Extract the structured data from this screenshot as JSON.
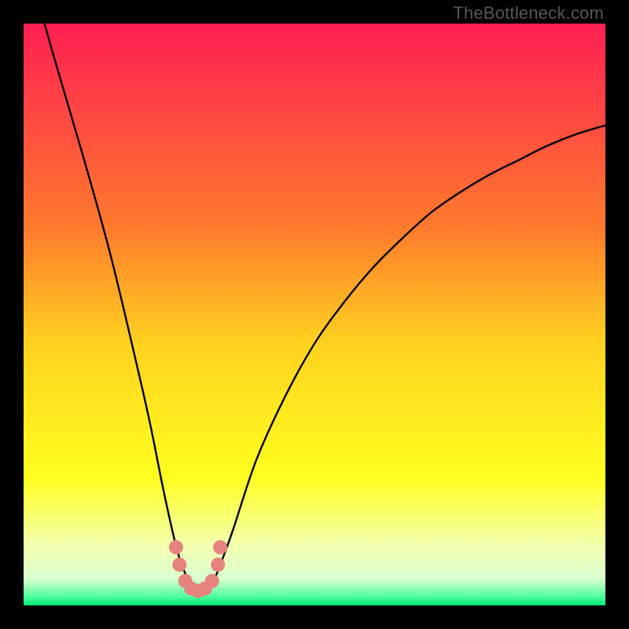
{
  "watermark": {
    "text": "TheBottleneck.com"
  },
  "chart_data": {
    "type": "line",
    "title": "",
    "xlabel": "",
    "ylabel": "",
    "xlim": [
      0,
      100
    ],
    "ylim": [
      0,
      100
    ],
    "x": [
      0,
      5,
      10,
      15,
      20,
      22,
      24,
      26,
      27,
      28,
      29,
      30,
      31,
      32,
      33,
      34,
      36,
      40,
      45,
      50,
      55,
      60,
      65,
      70,
      75,
      80,
      85,
      90,
      95,
      100
    ],
    "values": [
      113,
      95,
      78,
      60,
      39,
      30,
      20,
      11,
      7.5,
      5,
      3.2,
      2.5,
      2.5,
      3.2,
      5,
      7.5,
      13,
      25,
      36,
      45,
      52,
      58,
      63,
      67.5,
      71,
      74,
      76.5,
      79,
      81,
      82.5
    ],
    "minimum_x": 30,
    "gradient_stops": [
      {
        "pos": 0.0,
        "color": "#ff1f53"
      },
      {
        "pos": 0.35,
        "color": "#ff7a2d"
      },
      {
        "pos": 0.55,
        "color": "#ffd21f"
      },
      {
        "pos": 0.78,
        "color": "#ffff1f"
      },
      {
        "pos": 0.9,
        "color": "#f3ffb2"
      },
      {
        "pos": 0.955,
        "color": "#d8ffcf"
      },
      {
        "pos": 0.985,
        "color": "#4dff9e"
      },
      {
        "pos": 1.0,
        "color": "#00e774"
      }
    ],
    "markers": {
      "color": "#e6837f",
      "radius": 9,
      "points_x": [
        26.2,
        26.8,
        27.8,
        28.8,
        30.0,
        31.2,
        32.4,
        33.4,
        33.8
      ],
      "points_y": [
        10.0,
        7.0,
        4.2,
        2.9,
        2.5,
        2.9,
        4.2,
        7.0,
        10.0
      ]
    }
  }
}
